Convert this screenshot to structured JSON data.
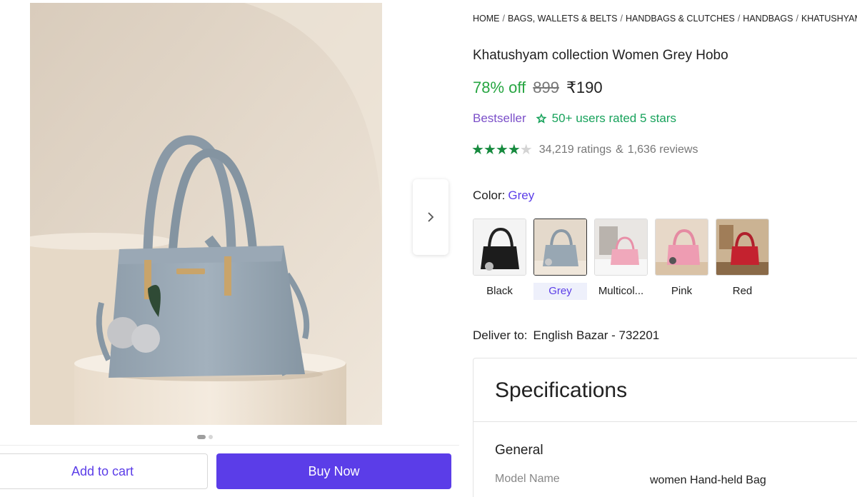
{
  "breadcrumb": [
    "HOME",
    "BAGS, WALLETS & BELTS",
    "HANDBAGS & CLUTCHES",
    "HANDBAGS",
    "KHATUSHYAM C"
  ],
  "product": {
    "title": "Khatushyam collection Women Grey Hobo",
    "discount": "78% off",
    "mrp": "899",
    "price": "₹190",
    "bestseller": "Bestseller",
    "users_rated": "50+ users rated 5 stars",
    "rating_stars": 4,
    "ratings_count": "34,219 ratings",
    "amp": "&",
    "reviews_count": "1,636 reviews"
  },
  "color": {
    "label": "Color:",
    "selected": "Grey",
    "options": [
      "Black",
      "Grey",
      "Multicol...",
      "Pink",
      "Red"
    ]
  },
  "delivery": {
    "label": "Deliver to:",
    "location": "English Bazar - 732201"
  },
  "specifications": {
    "title": "Specifications",
    "group": "General",
    "rows": [
      {
        "key": "Model Name",
        "value": "women Hand-held Bag"
      }
    ]
  },
  "gallery": {
    "image_count": 2,
    "current_index": 1
  },
  "actions": {
    "add_to_cart": "Add to cart",
    "buy_now": "Buy Now"
  },
  "icons": {
    "next": "chevron-right-icon",
    "rated": "star-badge-icon"
  },
  "colors": {
    "accent": "#5b3de8",
    "discount": "#26a541",
    "bestseller": "#7b4fc9",
    "rated": "#17a25b",
    "star": "#168a3e"
  }
}
